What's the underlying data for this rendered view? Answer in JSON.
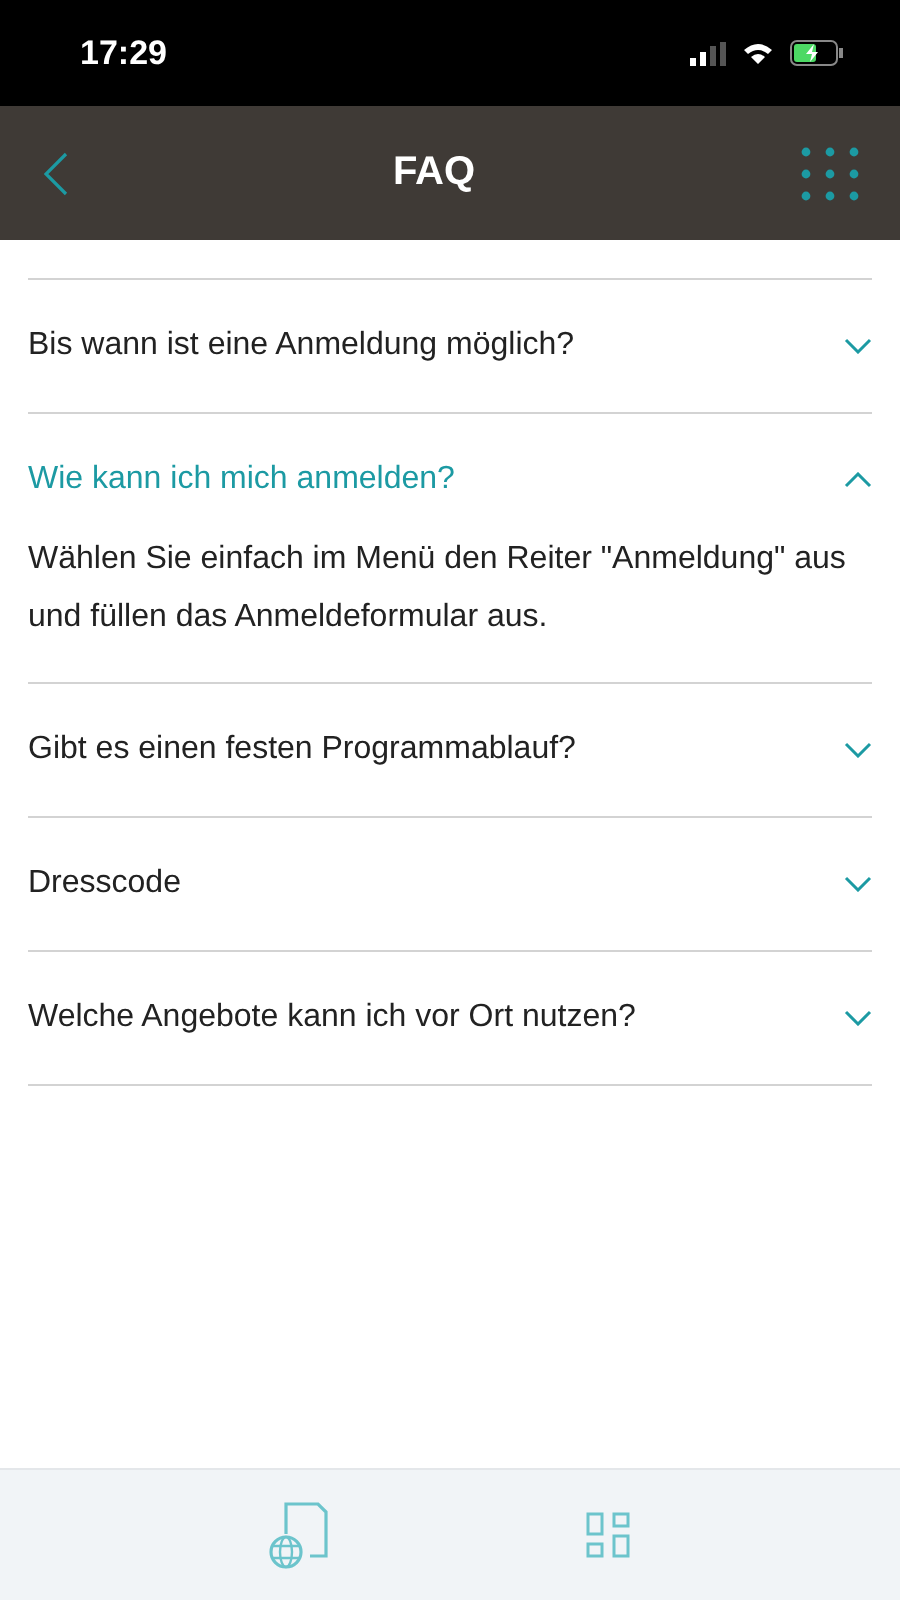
{
  "status_bar": {
    "time": "17:29"
  },
  "header": {
    "title": "FAQ"
  },
  "faqs": [
    {
      "question": "Bis wann ist eine Anmeldung möglich?",
      "expanded": false
    },
    {
      "question": "Wie kann ich mich anmelden?",
      "expanded": true,
      "answer": "Wählen Sie einfach im Menü den Reiter \"Anmeldung\" aus und füllen das Anmeldeformular aus."
    },
    {
      "question": "Gibt es einen festen Programmablauf?",
      "expanded": false
    },
    {
      "question": "Dresscode",
      "expanded": false
    },
    {
      "question": "Welche Angebote kann ich vor Ort nutzen?",
      "expanded": false
    }
  ]
}
